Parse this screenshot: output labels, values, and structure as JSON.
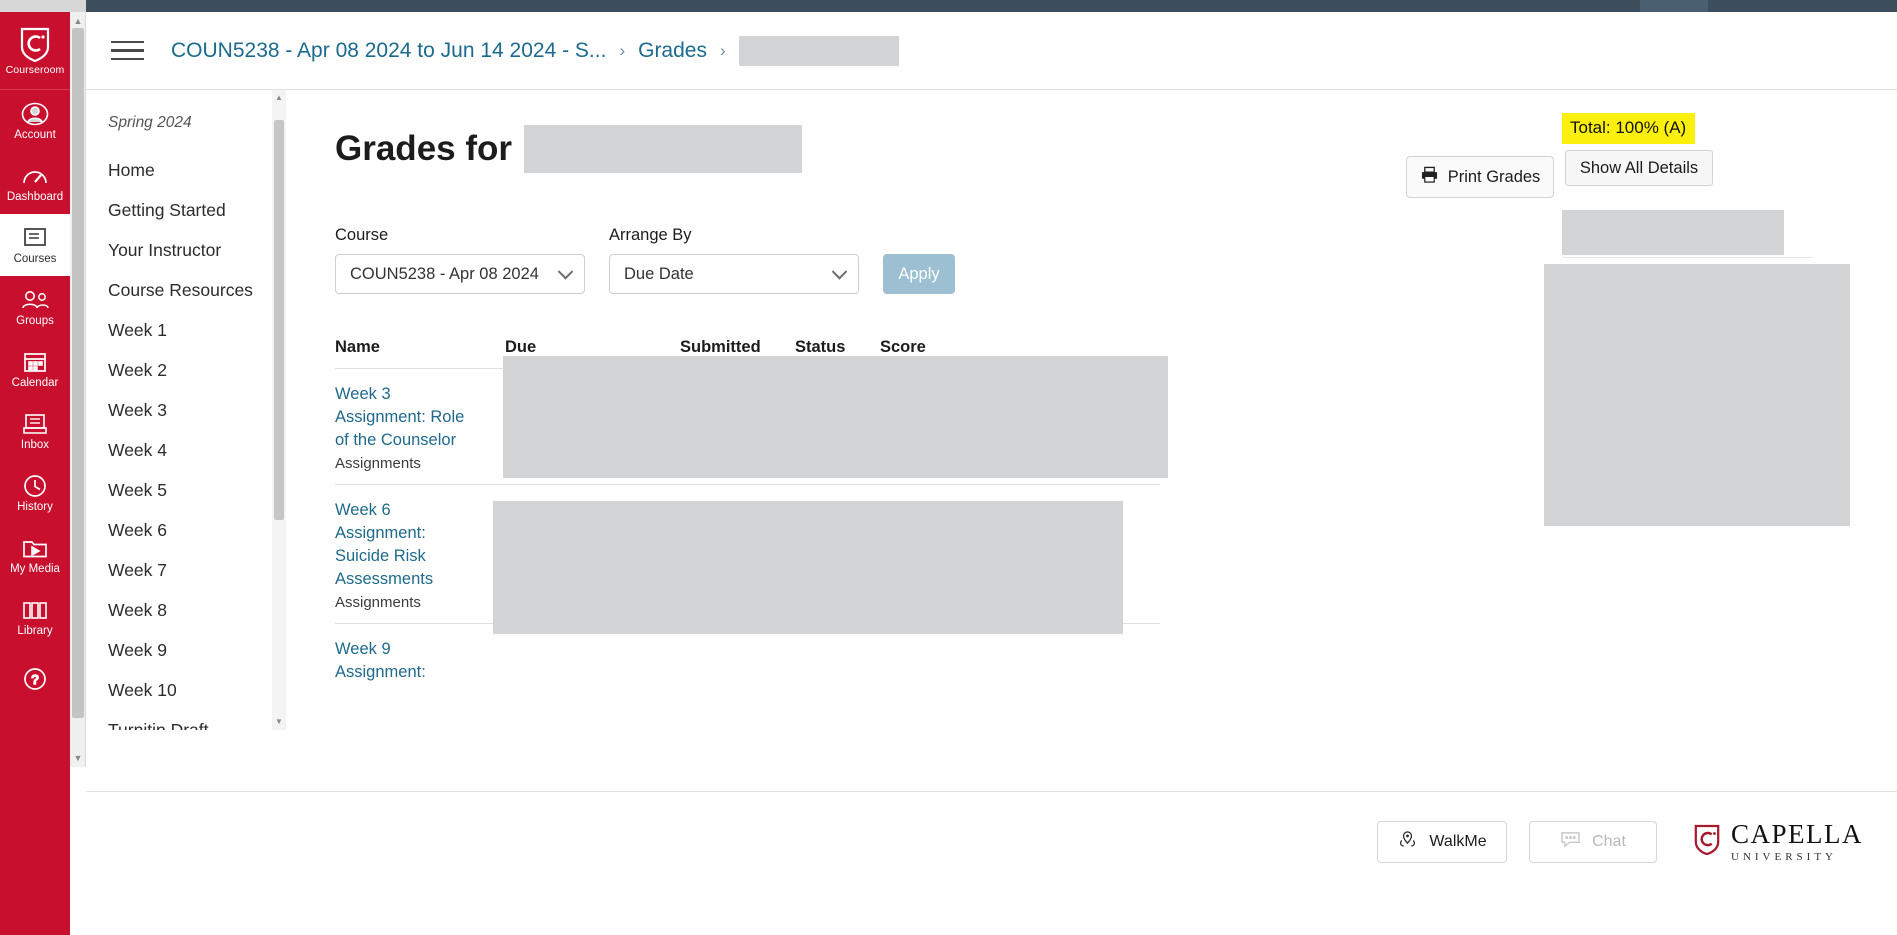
{
  "global_rail": {
    "brand": {
      "label": "Courseroom",
      "icon": "capella-shield-icon"
    },
    "items": [
      {
        "label": "Account",
        "icon": "user-circle-icon",
        "active": false
      },
      {
        "label": "Dashboard",
        "icon": "speedometer-icon",
        "active": false
      },
      {
        "label": "Courses",
        "icon": "book-icon",
        "active": true
      },
      {
        "label": "Groups",
        "icon": "people-icon",
        "active": false
      },
      {
        "label": "Calendar",
        "icon": "calendar-icon",
        "active": false
      },
      {
        "label": "Inbox",
        "icon": "inbox-icon",
        "active": false
      },
      {
        "label": "History",
        "icon": "clock-icon",
        "active": false
      },
      {
        "label": "My Media",
        "icon": "video-folder-icon",
        "active": false
      },
      {
        "label": "Library",
        "icon": "library-books-icon",
        "active": false
      },
      {
        "label": "",
        "icon": "help-circle-icon",
        "active": false
      }
    ]
  },
  "header": {
    "menu_icon": "hamburger-icon",
    "breadcrumb": [
      {
        "label": "COUN5238 - Apr 08 2024 to Jun 14 2024 - S...",
        "type": "link"
      },
      {
        "label": "Grades",
        "type": "link"
      },
      {
        "label": "",
        "type": "redacted"
      }
    ],
    "separator": "›"
  },
  "course_nav": {
    "term": "Spring 2024",
    "items": [
      {
        "label": "Home"
      },
      {
        "label": "Getting Started"
      },
      {
        "label": "Your Instructor"
      },
      {
        "label": "Course Resources"
      },
      {
        "label": "Week 1"
      },
      {
        "label": "Week 2"
      },
      {
        "label": "Week 3"
      },
      {
        "label": "Week 4"
      },
      {
        "label": "Week 5"
      },
      {
        "label": "Week 6"
      },
      {
        "label": "Week 7"
      },
      {
        "label": "Week 8"
      },
      {
        "label": "Week 9"
      },
      {
        "label": "Week 10"
      },
      {
        "label": "Turnitin Draft"
      }
    ]
  },
  "main": {
    "title": "Grades for",
    "student_name": "",
    "filters": {
      "course_label": "Course",
      "course_value": "COUN5238 - Apr 08 2024",
      "arrange_label": "Arrange By",
      "arrange_value": "Due Date",
      "apply_label": "Apply"
    },
    "table": {
      "columns": [
        "Name",
        "Due",
        "Submitted",
        "Status",
        "Score"
      ],
      "rows": [
        {
          "name": "Week 3 Assignment: Role of the Counselor",
          "group": "Assignments",
          "due": "",
          "submitted": "",
          "status": "",
          "score": ""
        },
        {
          "name": "Week 6 Assignment: Suicide Risk Assessments",
          "group": "Assignments",
          "due": "",
          "submitted": "",
          "status": "",
          "score": ""
        },
        {
          "name": "Week 9 Assignment:",
          "group": "",
          "due": "",
          "submitted": "",
          "status": "",
          "score": ""
        }
      ]
    }
  },
  "aside": {
    "print_label": "Print Grades",
    "print_icon": "printer-icon",
    "total_label": "Total: 100% (A)",
    "total_highlight_color": "#fbf00d",
    "show_details_label": "Show All Details"
  },
  "footer": {
    "walkme_label": "WalkMe",
    "walkme_icon": "location-pin-icon",
    "chat_label": "Chat",
    "chat_icon": "chat-bubble-icon",
    "chat_disabled": true,
    "logo_name": "CAPELLA",
    "logo_sub": "UNIVERSITY"
  }
}
